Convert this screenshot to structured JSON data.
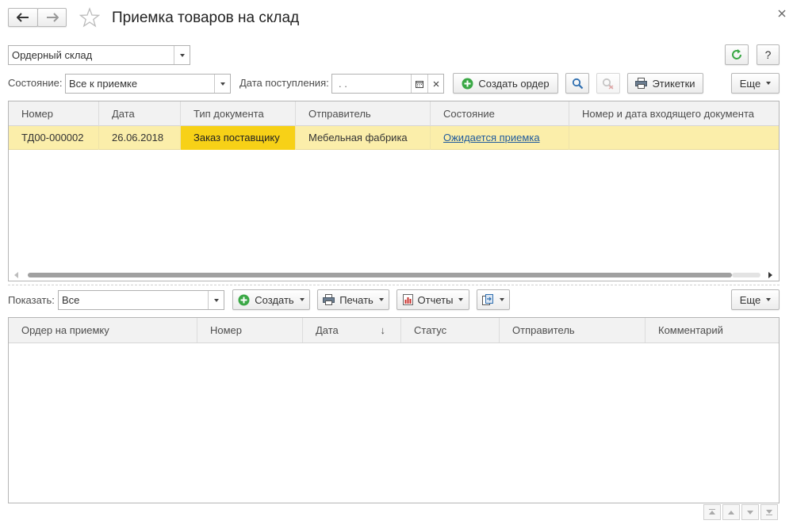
{
  "title": "Приемка товаров на склад",
  "warehouse": {
    "value": "Ордерный склад"
  },
  "filters": {
    "state_label": "Состояние:",
    "state_value": "Все к приемке",
    "date_label": "Дата поступления:",
    "date_value": " .  ."
  },
  "toolbar_top": {
    "create_order": "Создать ордер",
    "labels": "Этикетки",
    "more": "Еще",
    "help": "?"
  },
  "grid_top": {
    "columns": [
      "Номер",
      "Дата",
      "Тип документа",
      "Отправитель",
      "Состояние",
      "Номер и дата входящего документа"
    ],
    "rows": [
      {
        "number": "ТД00-000002",
        "date": "26.06.2018",
        "doc_type": "Заказ поставщику",
        "sender": "Мебельная фабрика",
        "state": "Ожидается приемка",
        "incoming": ""
      }
    ]
  },
  "toolbar_bottom": {
    "show_label": "Показать:",
    "show_value": "Все",
    "create": "Создать",
    "print": "Печать",
    "reports": "Отчеты",
    "more": "Еще"
  },
  "grid_bottom": {
    "columns": [
      "Ордер на приемку",
      "Номер",
      "Дата",
      "Статус",
      "Отправитель",
      "Комментарий"
    ],
    "sort_indicator": "↓"
  },
  "colors": {
    "selected_row": "#fbeeaa",
    "highlight_cell": "#f7d117",
    "link": "#1f5a9c",
    "green_icon": "#3aa845"
  },
  "icons": [
    "back-arrow-icon",
    "forward-arrow-icon",
    "star-icon",
    "close-icon",
    "refresh-icon",
    "calendar-icon",
    "search-icon",
    "clear-search-icon",
    "printer-icon",
    "plus-circle-icon",
    "report-icon",
    "export-icon"
  ]
}
